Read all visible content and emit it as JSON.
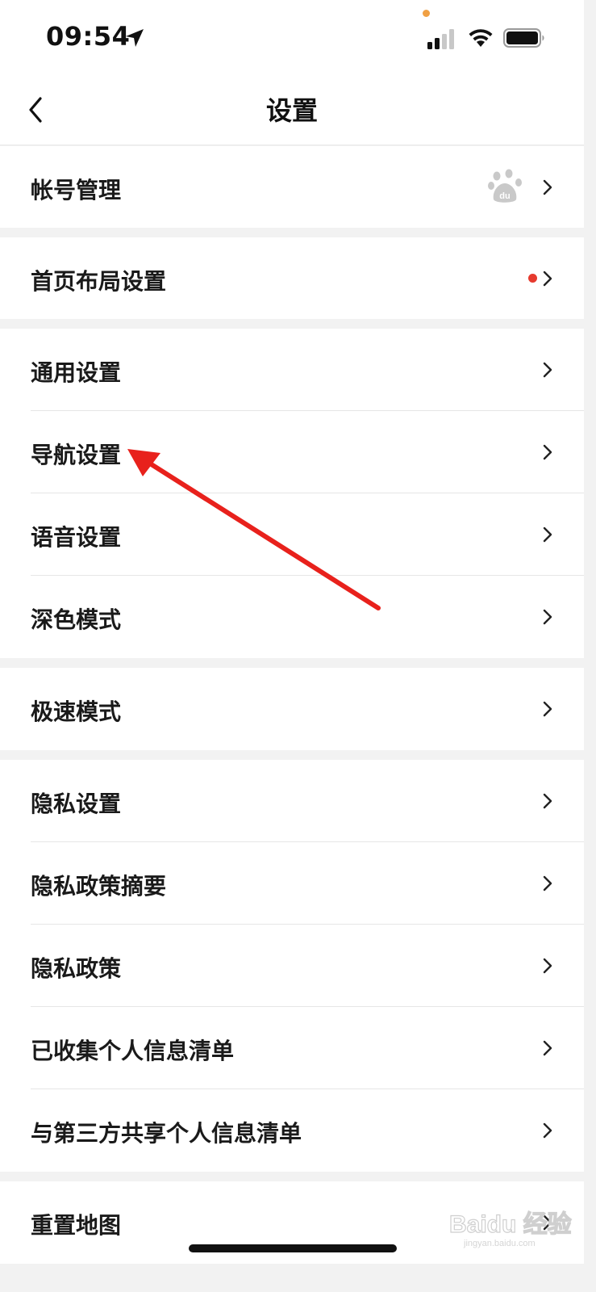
{
  "status_bar": {
    "time": "09:54"
  },
  "header": {
    "title": "设置"
  },
  "settings": [
    {
      "label": "帐号管理"
    },
    {
      "label": "首页布局设置"
    },
    {
      "label": "通用设置"
    },
    {
      "label": "导航设置"
    },
    {
      "label": "语音设置"
    },
    {
      "label": "深色模式"
    },
    {
      "label": "极速模式"
    },
    {
      "label": "隐私设置"
    },
    {
      "label": "隐私政策摘要"
    },
    {
      "label": "隐私政策"
    },
    {
      "label": "已收集个人信息清单"
    },
    {
      "label": "与第三方共享个人信息清单"
    },
    {
      "label": "重置地图"
    }
  ],
  "watermark": {
    "text": "Baidu 经验",
    "sub": "jingyan.baidu.com"
  },
  "colors": {
    "accent_dot": "#e63a2e",
    "arrow": "#e8211c",
    "background": "#f2f2f2"
  },
  "icons": [
    "location-arrow-icon",
    "signal-icon",
    "wifi-icon",
    "battery-icon",
    "back-chevron-icon",
    "baidu-paw-icon",
    "chevron-right-icon"
  ]
}
